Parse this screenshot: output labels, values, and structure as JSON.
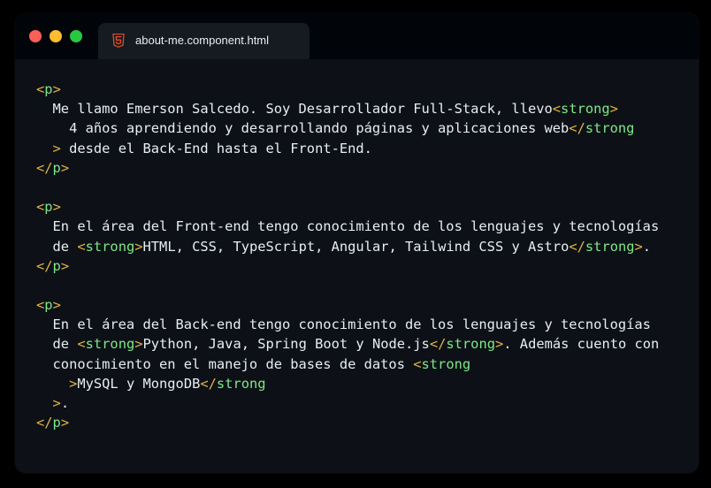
{
  "window": {
    "tab": {
      "filename": "about-me.component.html",
      "icon": "html5-icon"
    },
    "controls": [
      "close-button",
      "minimize-button",
      "maximize-button"
    ]
  },
  "colors": {
    "background": "#0d1117",
    "titlebar": "#010409",
    "tab": "#161b22",
    "tag_bracket": "#e3b341",
    "tag_name": "#7ee787",
    "text": "#e6edf3",
    "close": "#ff5f57",
    "minimize": "#febc2e",
    "maximize": "#28c840",
    "html5_icon": "#e34c26"
  },
  "code_lines": [
    [
      {
        "t": "tag",
        "v": "<"
      },
      {
        "t": "name",
        "v": "p"
      },
      {
        "t": "tag",
        "v": ">"
      }
    ],
    [
      {
        "t": "text",
        "v": "  Me llamo Emerson Salcedo. Soy Desarrollador Full-Stack, llevo"
      },
      {
        "t": "tag",
        "v": "<"
      },
      {
        "t": "name",
        "v": "strong"
      },
      {
        "t": "tag",
        "v": ">"
      }
    ],
    [
      {
        "t": "text",
        "v": "    4 años aprendiendo y desarrollando páginas y aplicaciones web"
      },
      {
        "t": "tag",
        "v": "</"
      },
      {
        "t": "name",
        "v": "strong"
      }
    ],
    [
      {
        "t": "text",
        "v": "  "
      },
      {
        "t": "tag",
        "v": ">"
      },
      {
        "t": "text",
        "v": " desde el Back-End hasta el Front-End."
      }
    ],
    [
      {
        "t": "tag",
        "v": "</"
      },
      {
        "t": "name",
        "v": "p"
      },
      {
        "t": "tag",
        "v": ">"
      }
    ],
    [],
    [
      {
        "t": "tag",
        "v": "<"
      },
      {
        "t": "name",
        "v": "p"
      },
      {
        "t": "tag",
        "v": ">"
      }
    ],
    [
      {
        "t": "text",
        "v": "  En el área del Front-end tengo conocimiento de los lenguajes y tecnologías"
      }
    ],
    [
      {
        "t": "text",
        "v": "  de "
      },
      {
        "t": "tag",
        "v": "<"
      },
      {
        "t": "name",
        "v": "strong"
      },
      {
        "t": "tag",
        "v": ">"
      },
      {
        "t": "text",
        "v": "HTML, CSS, TypeScript, Angular, Tailwind CSS y Astro"
      },
      {
        "t": "tag",
        "v": "</"
      },
      {
        "t": "name",
        "v": "strong"
      },
      {
        "t": "tag",
        "v": ">"
      },
      {
        "t": "text",
        "v": "."
      }
    ],
    [
      {
        "t": "tag",
        "v": "</"
      },
      {
        "t": "name",
        "v": "p"
      },
      {
        "t": "tag",
        "v": ">"
      }
    ],
    [],
    [
      {
        "t": "tag",
        "v": "<"
      },
      {
        "t": "name",
        "v": "p"
      },
      {
        "t": "tag",
        "v": ">"
      }
    ],
    [
      {
        "t": "text",
        "v": "  En el área del Back-end tengo conocimiento de los lenguajes y tecnologías"
      }
    ],
    [
      {
        "t": "text",
        "v": "  de "
      },
      {
        "t": "tag",
        "v": "<"
      },
      {
        "t": "name",
        "v": "strong"
      },
      {
        "t": "tag",
        "v": ">"
      },
      {
        "t": "text",
        "v": "Python, Java, Spring Boot y Node.js"
      },
      {
        "t": "tag",
        "v": "</"
      },
      {
        "t": "name",
        "v": "strong"
      },
      {
        "t": "tag",
        "v": ">"
      },
      {
        "t": "text",
        "v": ". Además cuento con"
      }
    ],
    [
      {
        "t": "text",
        "v": "  conocimiento en el manejo de bases de datos "
      },
      {
        "t": "tag",
        "v": "<"
      },
      {
        "t": "name",
        "v": "strong"
      }
    ],
    [
      {
        "t": "text",
        "v": "    "
      },
      {
        "t": "tag",
        "v": ">"
      },
      {
        "t": "text",
        "v": "MySQL y MongoDB"
      },
      {
        "t": "tag",
        "v": "</"
      },
      {
        "t": "name",
        "v": "strong"
      }
    ],
    [
      {
        "t": "text",
        "v": "  "
      },
      {
        "t": "tag",
        "v": ">"
      },
      {
        "t": "text",
        "v": "."
      }
    ],
    [
      {
        "t": "tag",
        "v": "</"
      },
      {
        "t": "name",
        "v": "p"
      },
      {
        "t": "tag",
        "v": ">"
      }
    ]
  ]
}
